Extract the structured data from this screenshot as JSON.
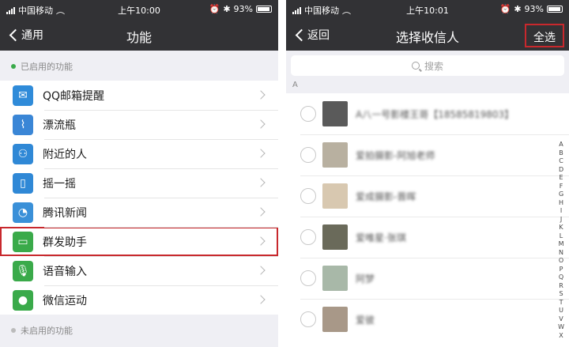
{
  "left": {
    "status": {
      "carrier": "中国移动",
      "time": "上午10:00",
      "battery": "93%"
    },
    "nav": {
      "back_label": "通用",
      "title": "功能"
    },
    "enabled_header": "已启用的功能",
    "items": [
      {
        "label": "QQ邮箱提醒",
        "icon": "mail-icon",
        "color": "#2f8bd9"
      },
      {
        "label": "漂流瓶",
        "icon": "drift-bottle-icon",
        "color": "#3a86d6"
      },
      {
        "label": "附近的人",
        "icon": "people-nearby-icon",
        "color": "#2f88d6"
      },
      {
        "label": "摇一摇",
        "icon": "shake-icon",
        "color": "#2f88d6"
      },
      {
        "label": "腾讯新闻",
        "icon": "news-icon",
        "color": "#3a90d8"
      },
      {
        "label": "群发助手",
        "icon": "mass-message-icon",
        "color": "#3aaa4a"
      },
      {
        "label": "语音输入",
        "icon": "microphone-icon",
        "color": "#3aaa4a"
      },
      {
        "label": "微信运动",
        "icon": "wechat-sports-icon",
        "color": "#3aaa4a"
      }
    ],
    "disabled_header": "未启用的功能"
  },
  "right": {
    "status": {
      "carrier": "中国移动",
      "time": "上午10:01",
      "battery": "93%"
    },
    "nav": {
      "back_label": "返回",
      "title": "选择收信人",
      "select_all": "全选"
    },
    "search_placeholder": "搜索",
    "section_letter": "A",
    "contacts": [
      {
        "name": "A八一号影楼王哥【18585819803】",
        "avatar_color": "#5a5a5a"
      },
      {
        "name": "爱拍摄影-阿旭老师",
        "avatar_color": "#b8b0a0"
      },
      {
        "name": "爱成摄影-晋晖",
        "avatar_color": "#d8c8b0"
      },
      {
        "name": "爱唯星·张琪",
        "avatar_color": "#6a6a5a"
      },
      {
        "name": "阿梦",
        "avatar_color": "#a8b8a8"
      },
      {
        "name": "爱彼",
        "avatar_color": "#a89888"
      }
    ],
    "index_letters": [
      "A",
      "B",
      "C",
      "D",
      "E",
      "F",
      "G",
      "H",
      "I",
      "J",
      "K",
      "L",
      "M",
      "N",
      "O",
      "P",
      "Q",
      "R",
      "S",
      "T",
      "U",
      "V",
      "W",
      "X"
    ]
  }
}
